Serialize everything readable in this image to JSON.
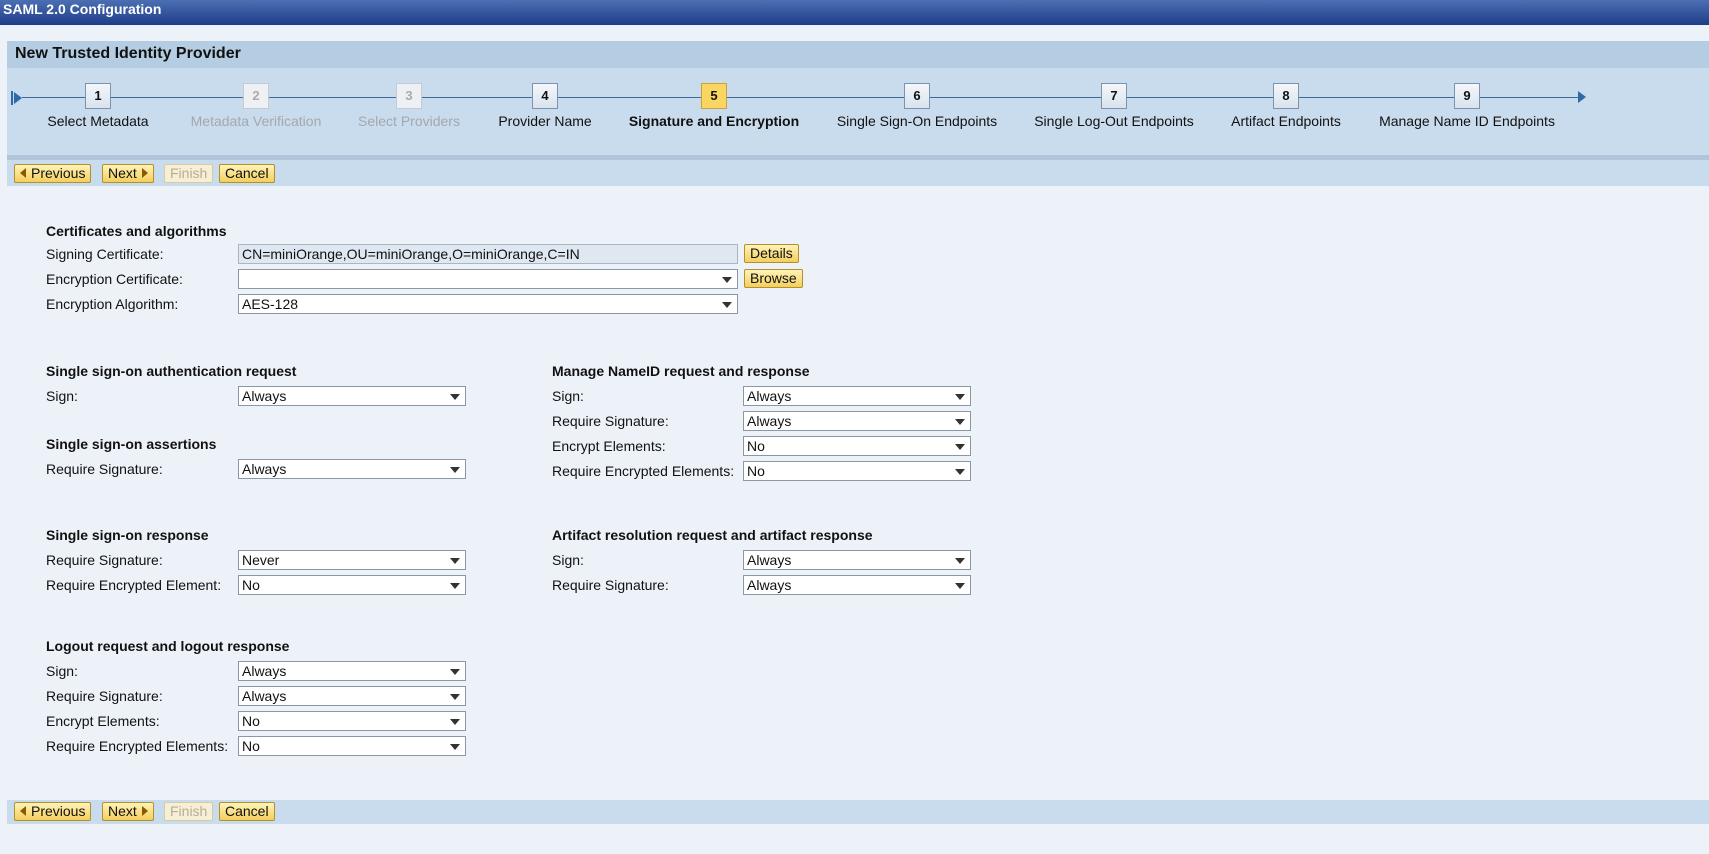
{
  "window_title": "SAML 2.0 Configuration",
  "panel_title": "New Trusted Identity Provider",
  "steps": [
    {
      "num": "1",
      "label": "Select Metadata",
      "state": "done"
    },
    {
      "num": "2",
      "label": "Metadata Verification",
      "state": "disabled"
    },
    {
      "num": "3",
      "label": "Select Providers",
      "state": "disabled"
    },
    {
      "num": "4",
      "label": "Provider Name",
      "state": "done"
    },
    {
      "num": "5",
      "label": "Signature and Encryption",
      "state": "current"
    },
    {
      "num": "6",
      "label": "Single Sign-On Endpoints",
      "state": "todo"
    },
    {
      "num": "7",
      "label": "Single Log-Out Endpoints",
      "state": "todo"
    },
    {
      "num": "8",
      "label": "Artifact Endpoints",
      "state": "todo"
    },
    {
      "num": "9",
      "label": "Manage Name ID Endpoints",
      "state": "todo"
    }
  ],
  "buttons": {
    "previous": "Previous",
    "next": "Next",
    "finish": "Finish",
    "cancel": "Cancel",
    "details": "Details",
    "browse": "Browse"
  },
  "certs": {
    "heading": "Certificates and algorithms",
    "signing_label": "Signing Certificate:",
    "signing_value": "CN=miniOrange,OU=miniOrange,O=miniOrange,C=IN",
    "encryption_label": "Encryption Certificate:",
    "encryption_value": "",
    "algorithm_label": "Encryption Algorithm:",
    "algorithm_value": "AES-128"
  },
  "sso_request": {
    "heading": "Single sign-on authentication request",
    "sign_label": "Sign:",
    "sign": "Always"
  },
  "sso_assertions": {
    "heading": "Single sign-on assertions",
    "req_sig_label": "Require Signature:",
    "req_sig": "Always"
  },
  "sso_response": {
    "heading": "Single sign-on response",
    "req_sig_label": "Require Signature:",
    "req_sig": "Never",
    "req_enc_label": "Require Encrypted Element:",
    "req_enc": "No"
  },
  "logout": {
    "heading": "Logout request and logout response",
    "sign_label": "Sign:",
    "sign": "Always",
    "req_sig_label": "Require Signature:",
    "req_sig": "Always",
    "enc_label": "Encrypt Elements:",
    "enc": "No",
    "req_enc_label": "Require Encrypted Elements:",
    "req_enc": "No"
  },
  "nameid": {
    "heading": "Manage NameID request and response",
    "sign_label": "Sign:",
    "sign": "Always",
    "req_sig_label": "Require Signature:",
    "req_sig": "Always",
    "enc_label": "Encrypt Elements:",
    "enc": "No",
    "req_enc_label": "Require Encrypted Elements:",
    "req_enc": "No"
  },
  "artifact": {
    "heading": "Artifact resolution request and artifact response",
    "sign_label": "Sign:",
    "sign": "Always",
    "req_sig_label": "Require Signature:",
    "req_sig": "Always"
  }
}
